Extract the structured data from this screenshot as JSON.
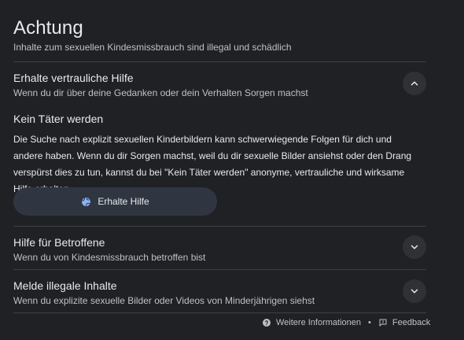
{
  "header": {
    "title": "Achtung",
    "subtitle": "Inhalte zum sexuellen Kindesmissbrauch sind illegal und schädlich"
  },
  "sections": [
    {
      "title": "Erhalte vertrauliche Hilfe",
      "subtitle": "Wenn du dir über deine Gedanken oder dein Verhalten Sorgen machst",
      "expanded": true,
      "content": {
        "heading": "Kein Täter werden",
        "body": "Die Suche nach explizit sexuellen Kinderbildern kann schwerwiegende Folgen für dich und andere haben. Wenn du dir Sorgen machst, weil du dir sexuelle Bilder ansiehst oder den Drang verspürst dies zu tun, kannst du bei \"Kein Täter werden\" anonyme, vertrauliche und wirksame Hilfe erhalten.",
        "button_label": "Erhalte Hilfe",
        "button_icon": "globe-icon"
      }
    },
    {
      "title": "Hilfe für Betroffene",
      "subtitle": "Wenn du von Kindesmissbrauch betroffen bist",
      "expanded": false
    },
    {
      "title": "Melde illegale Inhalte",
      "subtitle": "Wenn du explizite sexuelle Bilder oder Videos von Minderjährigen siehst",
      "expanded": false
    }
  ],
  "footer": {
    "more_info": "Weitere Informationen",
    "separator": "•",
    "feedback": "Feedback"
  },
  "colors": {
    "background": "#202124",
    "text": "#e8eaed",
    "secondary_text": "#bdc1c6",
    "divider": "#3c4043",
    "chevron_button": "#303134",
    "help_button": "#303542",
    "globe_icon": "#8ab4f8"
  }
}
